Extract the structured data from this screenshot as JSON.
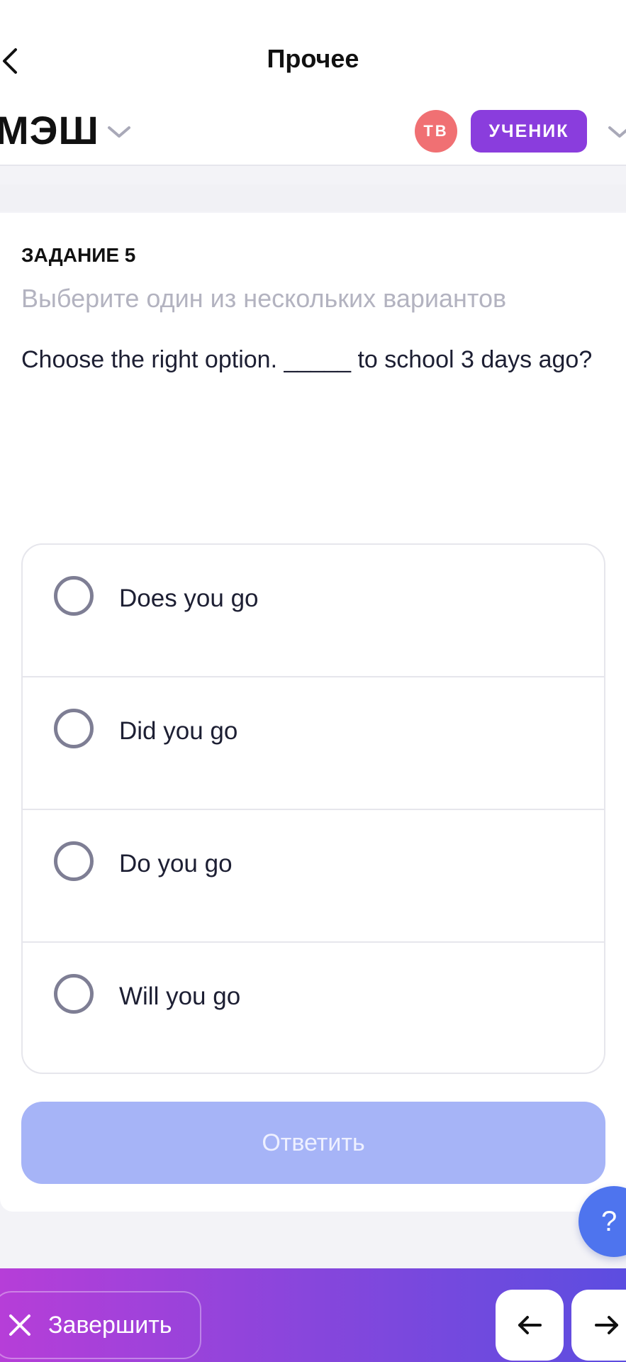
{
  "header": {
    "title": "Прочее",
    "brand": "МЭШ",
    "avatar_initials": "ТВ",
    "role": "УЧЕНИК"
  },
  "task": {
    "number_label": "ЗАДАНИЕ 5",
    "hint": "Выберите один из нескольких вариантов",
    "question": "Choose the right option. _____  to school 3 days ago?"
  },
  "options": [
    {
      "label": "Does you go",
      "selected": false
    },
    {
      "label": "Did you go",
      "selected": false
    },
    {
      "label": "Do you go",
      "selected": false
    },
    {
      "label": "Will you go",
      "selected": false
    }
  ],
  "submit_label": "Ответить",
  "help_label": "?",
  "footer": {
    "finish_label": "Завершить"
  },
  "colors": {
    "accent": "#8a3ddd",
    "avatar": "#f07073",
    "submit_disabled": "#a6b4f7",
    "help": "#4e74ee"
  },
  "icons": {
    "back": "chevron-left-icon",
    "brand_menu": "chevron-down-icon",
    "role_menu": "chevron-down-icon",
    "finish": "close-icon",
    "prev": "arrow-left-icon",
    "next": "arrow-right-icon"
  }
}
